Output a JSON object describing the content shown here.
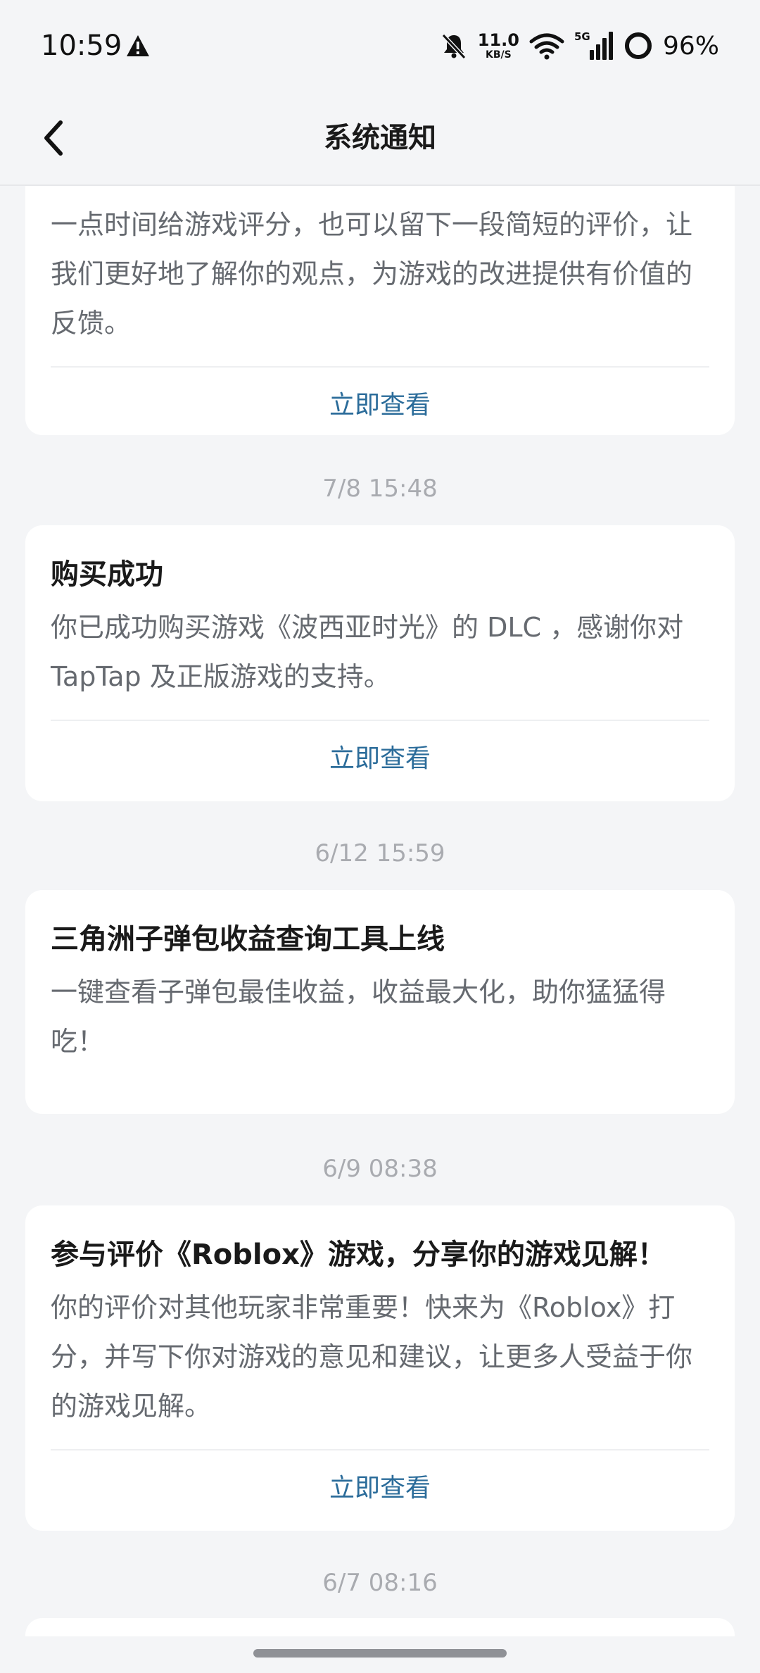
{
  "status_bar": {
    "time": "10:59",
    "net_speed_value": "11.0",
    "net_speed_unit": "KB/S",
    "network_type": "5G",
    "battery": "96%"
  },
  "header": {
    "title": "系统通知"
  },
  "notifications": [
    {
      "body": "一点时间给游戏评分，也可以留下一段简短的评价，让我们更好地了解你的观点，为游戏的改进提供有价值的反馈。",
      "action": "立即查看"
    },
    {
      "date": "7/8  15:48",
      "title": "购买成功",
      "body": "你已成功购买游戏《波西亚时光》的 DLC ，感谢你对 TapTap 及正版游戏的支持。",
      "action": "立即查看"
    },
    {
      "date": "6/12  15:59",
      "title": "三角洲子弹包收益查询工具上线",
      "body": "一键查看子弹包最佳收益，收益最大化，助你猛猛得吃！"
    },
    {
      "date": "6/9  08:38",
      "title": "参与评价《Roblox》游戏，分享你的游戏见解！",
      "body": "你的评价对其他玩家非常重要！快来为《Roblox》打分，并写下你对游戏的意见和建议，让更多人受益于你的游戏见解。",
      "action": "立即查看"
    },
    {
      "date": "6/7  08:16"
    }
  ]
}
